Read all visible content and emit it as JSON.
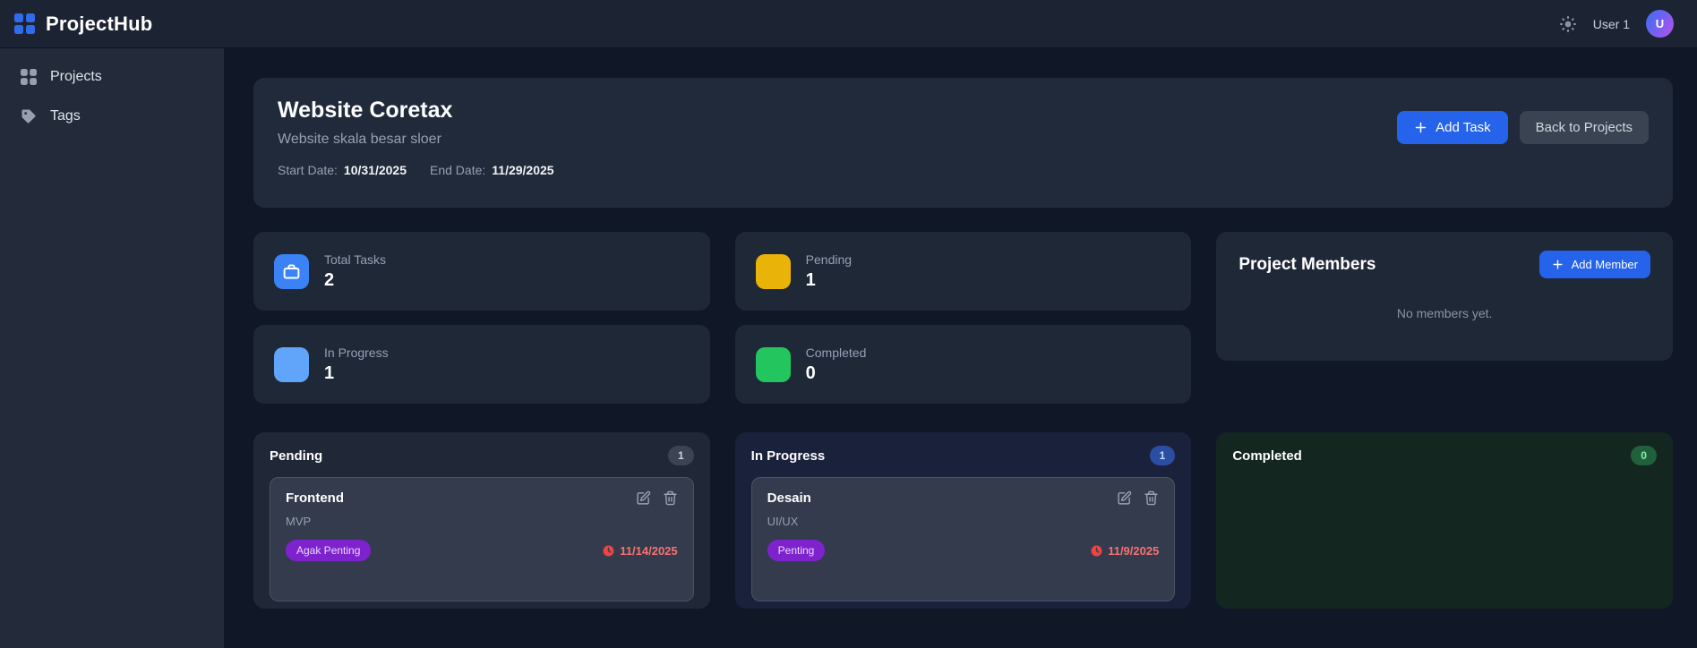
{
  "topbar": {
    "app_name": "ProjectHub",
    "user_name": "User 1",
    "avatar_initial": "U"
  },
  "sidebar": {
    "items": [
      {
        "label": "Projects",
        "icon": "grid-icon"
      },
      {
        "label": "Tags",
        "icon": "tag-icon"
      }
    ]
  },
  "project_header": {
    "title": "Website Coretax",
    "subtitle": "Website skala besar sloer",
    "start_date_label": "Start Date:",
    "start_date": "10/31/2025",
    "end_date_label": "End Date:",
    "end_date": "11/29/2025",
    "add_task_label": "Add Task",
    "back_label": "Back to Projects"
  },
  "stats": [
    {
      "label": "Total Tasks",
      "value": "2",
      "color": "#3b82f6",
      "icon": "briefcase-icon"
    },
    {
      "label": "Pending",
      "value": "1",
      "color": "#eab308"
    },
    {
      "label": "In Progress",
      "value": "1",
      "color": "#60a5fa"
    },
    {
      "label": "Completed",
      "value": "0",
      "color": "#22c55e"
    }
  ],
  "members": {
    "title": "Project Members",
    "add_label": "Add Member",
    "empty_text": "No members yet."
  },
  "board": {
    "columns": [
      {
        "name": "Pending",
        "count": "1",
        "tasks": [
          {
            "title": "Frontend",
            "description": "MVP",
            "tag": "Agak Penting",
            "due_date": "11/14/2025"
          }
        ]
      },
      {
        "name": "In Progress",
        "count": "1",
        "tasks": [
          {
            "title": "Desain",
            "description": "UI/UX",
            "tag": "Penting",
            "due_date": "11/9/2025"
          }
        ]
      },
      {
        "name": "Completed",
        "count": "0",
        "tasks": []
      }
    ]
  },
  "colors": {
    "accent_blue": "#2563eb",
    "tag_purple": "#7e22ce",
    "due_red": "#f87171",
    "pending_yellow": "#eab308",
    "progress_blue": "#60a5fa",
    "completed_green": "#22c55e"
  }
}
